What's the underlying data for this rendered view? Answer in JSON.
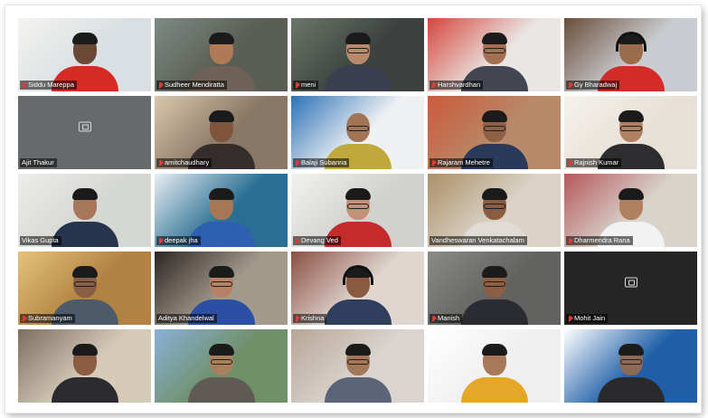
{
  "participants": [
    {
      "name": "Siddu Mareppa",
      "bg": "#d9dfe2",
      "accent": "#f4f4f0",
      "skin": "#6a4a36",
      "shirt": "#d62b25",
      "hair": true,
      "glasses": false,
      "headset": false,
      "muted": true,
      "video": true
    },
    {
      "name": "Sudheer Mendiratta",
      "bg": "#5a5e54",
      "accent": "#7e8a84",
      "skin": "#b07a56",
      "shirt": "#6e6258",
      "hair": true,
      "glasses": false,
      "headset": false,
      "muted": true,
      "video": true
    },
    {
      "name": "meni",
      "bg": "#3d4240",
      "accent": "#6c7668",
      "skin": "#b78a6c",
      "shirt": "#3a3f52",
      "hair": true,
      "glasses": true,
      "headset": false,
      "muted": true,
      "video": true
    },
    {
      "name": "Harshvardhan",
      "bg": "#e9e6e3",
      "accent": "#d6453d",
      "skin": "#a47054",
      "shirt": "#434651",
      "hair": true,
      "glasses": true,
      "headset": false,
      "muted": true,
      "video": true
    },
    {
      "name": "Gy Bharadwaj",
      "bg": "#c9ccd0",
      "accent": "#6a4e3a",
      "skin": "#9a6c4c",
      "shirt": "#d32c28",
      "hair": true,
      "glasses": false,
      "headset": true,
      "muted": true,
      "video": true
    },
    {
      "name": "Ajit Thakur",
      "bg": "#666a6d",
      "accent": "#666a6d",
      "skin": "#000000",
      "shirt": "#000000",
      "hair": false,
      "glasses": false,
      "headset": false,
      "muted": false,
      "video": false
    },
    {
      "name": "amitchaudhary",
      "bg": "#8a7866",
      "accent": "#d9c7ac",
      "skin": "#7c553c",
      "shirt": "#332e2c",
      "hair": true,
      "glasses": false,
      "headset": false,
      "muted": true,
      "video": true
    },
    {
      "name": "Balaji Subanna",
      "bg": "#eef0f2",
      "accent": "#2c72b8",
      "skin": "#a27456",
      "shirt": "#c0a83a",
      "hair": false,
      "glasses": true,
      "headset": false,
      "muted": true,
      "video": true
    },
    {
      "name": "Rajaram Mehetre",
      "bg": "#b88a6a",
      "accent": "#cc5a3a",
      "skin": "#8e6046",
      "shirt": "#2a3a5a",
      "hair": true,
      "glasses": true,
      "headset": false,
      "muted": true,
      "video": true
    },
    {
      "name": "Rajnish Kumar",
      "bg": "#e7e1d7",
      "accent": "#f5f2ec",
      "skin": "#b08062",
      "shirt": "#2d2d2f",
      "hair": true,
      "glasses": true,
      "headset": false,
      "muted": true,
      "video": true
    },
    {
      "name": "Vikas Gupta",
      "bg": "#d5d7d3",
      "accent": "#ecedeb",
      "skin": "#a6775a",
      "shirt": "#27344d",
      "hair": true,
      "glasses": false,
      "headset": false,
      "muted": false,
      "video": true
    },
    {
      "name": "deepak jha",
      "bg": "#2a6f93",
      "accent": "#e8eef2",
      "skin": "#a67656",
      "shirt": "#2e5fb0",
      "hair": true,
      "glasses": false,
      "headset": false,
      "muted": true,
      "video": true
    },
    {
      "name": "Devang Ved",
      "bg": "#d1d2cf",
      "accent": "#f2f2f0",
      "skin": "#c49078",
      "shirt": "#c42b2b",
      "hair": true,
      "glasses": true,
      "headset": false,
      "muted": true,
      "video": true
    },
    {
      "name": "Vandheswaran Venkatachalam",
      "bg": "#dad3c6",
      "accent": "#ab8f68",
      "skin": "#8a5c40",
      "shirt": "#e0dbd5",
      "hair": true,
      "glasses": true,
      "headset": false,
      "muted": false,
      "video": true
    },
    {
      "name": "Dharmendra Rana",
      "bg": "#d8d4cc",
      "accent": "#b6585a",
      "skin": "#b08060",
      "shirt": "#f2f2f2",
      "hair": true,
      "glasses": false,
      "headset": false,
      "muted": true,
      "video": true
    },
    {
      "name": "Subramanyam",
      "bg": "#b28242",
      "accent": "#e4c27a",
      "skin": "#8a5e44",
      "shirt": "#4d5a6a",
      "hair": true,
      "glasses": true,
      "headset": false,
      "muted": true,
      "video": true
    },
    {
      "name": "Aditya Khandelwal",
      "bg": "#a49a8c",
      "accent": "#2c2624",
      "skin": "#b58266",
      "shirt": "#2c4fa6",
      "hair": true,
      "glasses": true,
      "headset": false,
      "muted": false,
      "video": true
    },
    {
      "name": "Krishna",
      "bg": "#dfd6d0",
      "accent": "#8c4f42",
      "skin": "#8a5a40",
      "shirt": "#2e3e5c",
      "hair": true,
      "glasses": false,
      "headset": true,
      "muted": true,
      "video": true
    },
    {
      "name": "Manish",
      "bg": "#626260",
      "accent": "#8a8a86",
      "skin": "#8c5e44",
      "shirt": "#2a2c32",
      "hair": true,
      "glasses": true,
      "headset": false,
      "muted": true,
      "video": true
    },
    {
      "name": "Mohit Jain",
      "bg": "#262626",
      "accent": "#262626",
      "skin": "#000000",
      "shirt": "#000000",
      "hair": false,
      "glasses": false,
      "headset": false,
      "muted": true,
      "video": false
    },
    {
      "name": "",
      "bg": "#d6cbb9",
      "accent": "#7a6f60",
      "skin": "#8c5c42",
      "shirt": "#2b2b30",
      "hair": true,
      "glasses": false,
      "headset": false,
      "muted": false,
      "video": true
    },
    {
      "name": "",
      "bg": "#6f8f66",
      "accent": "#8ab0d8",
      "skin": "#a8805e",
      "shirt": "#5f5a54",
      "hair": true,
      "glasses": true,
      "headset": false,
      "muted": false,
      "video": true
    },
    {
      "name": "",
      "bg": "#d9d4cf",
      "accent": "#b8a596",
      "skin": "#a27858",
      "shirt": "#5c6478",
      "hair": true,
      "glasses": true,
      "headset": false,
      "muted": false,
      "video": true
    },
    {
      "name": "",
      "bg": "#efeff0",
      "accent": "#ffffff",
      "skin": "#a87858",
      "shirt": "#e6a627",
      "hair": true,
      "glasses": false,
      "headset": false,
      "muted": false,
      "video": true
    },
    {
      "name": "",
      "bg": "#1f5fa8",
      "accent": "#ffffff",
      "skin": "#8e6a56",
      "shirt": "#2a2a2e",
      "hair": true,
      "glasses": true,
      "headset": false,
      "muted": false,
      "video": true
    }
  ]
}
